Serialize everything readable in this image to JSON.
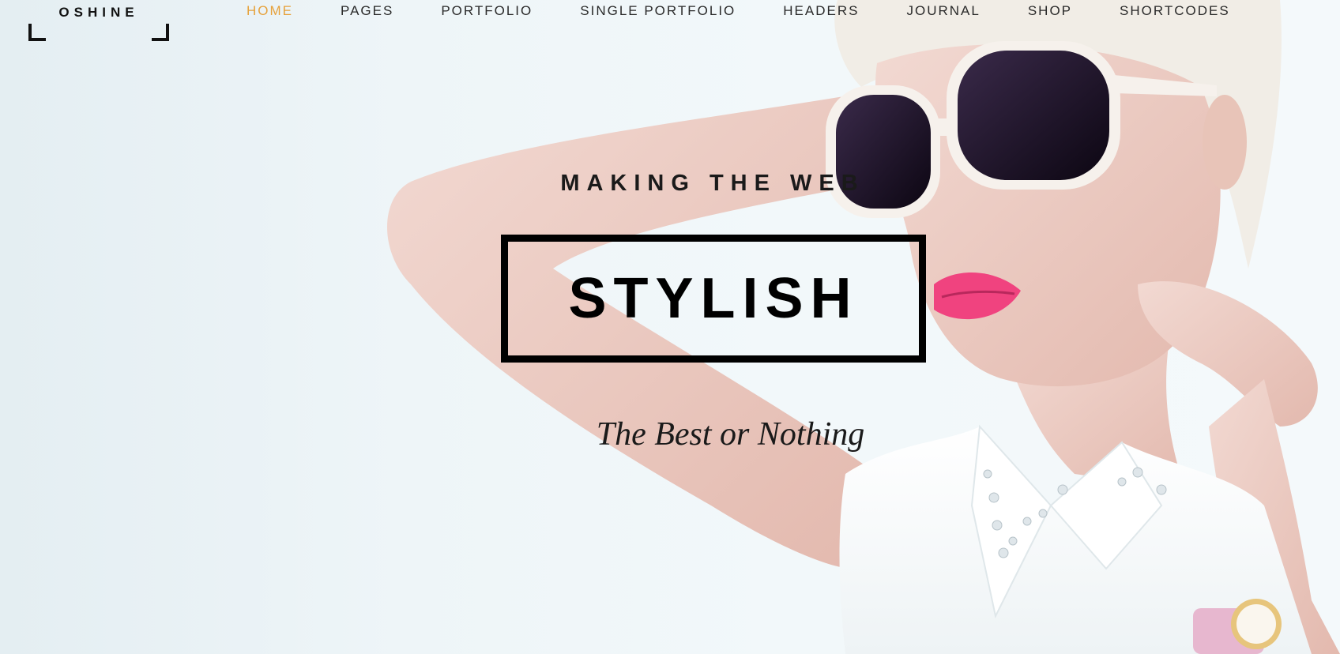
{
  "logo": {
    "text": "OSHINE"
  },
  "nav": {
    "items": [
      {
        "label": "HOME",
        "active": true
      },
      {
        "label": "PAGES",
        "active": false
      },
      {
        "label": "PORTFOLIO",
        "active": false
      },
      {
        "label": "SINGLE PORTFOLIO",
        "active": false
      },
      {
        "label": "HEADERS",
        "active": false
      },
      {
        "label": "JOURNAL",
        "active": false
      },
      {
        "label": "SHOP",
        "active": false
      },
      {
        "label": "SHORTCODES",
        "active": false
      }
    ]
  },
  "hero": {
    "kicker": "MAKING THE WEB",
    "title": "STYLISH",
    "tagline": "The Best or Nothing"
  },
  "colors": {
    "accent": "#e6a23c",
    "text": "#1a1a1a",
    "background": "#eef5f8"
  }
}
